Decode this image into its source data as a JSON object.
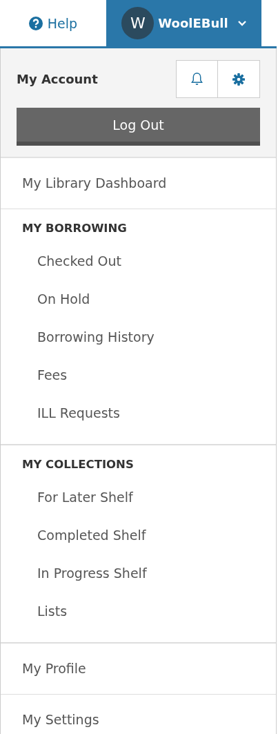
{
  "nav": {
    "help": "Help",
    "user": {
      "initial": "W",
      "name": "WoolEBull",
      "expanded": true
    }
  },
  "account": {
    "title": "My Account",
    "logout": "Log Out"
  },
  "menu": [
    {
      "kind": "link",
      "label": "My Library Dashboard"
    },
    {
      "kind": "section",
      "heading": "MY BORROWING",
      "items": [
        "Checked Out",
        "On Hold",
        "Borrowing History",
        "Fees",
        "ILL Requests"
      ]
    },
    {
      "kind": "section",
      "heading": "MY COLLECTIONS",
      "items": [
        "For Later Shelf",
        "Completed Shelf",
        "In Progress Shelf",
        "Lists"
      ]
    },
    {
      "kind": "link",
      "label": "My Profile"
    },
    {
      "kind": "link",
      "label": "My Settings"
    }
  ]
}
